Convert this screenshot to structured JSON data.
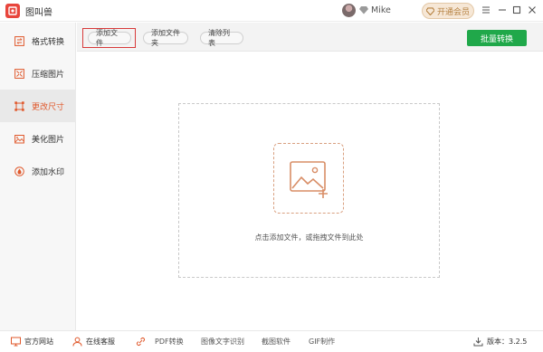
{
  "app": {
    "title": "图叫兽"
  },
  "user": {
    "name": "Mike",
    "member_label": "开通会员"
  },
  "sidebar": {
    "items": [
      {
        "label": "格式转换",
        "icon": "format-convert-icon"
      },
      {
        "label": "压缩图片",
        "icon": "compress-icon"
      },
      {
        "label": "更改尺寸",
        "icon": "resize-icon",
        "active": true
      },
      {
        "label": "美化图片",
        "icon": "beautify-icon"
      },
      {
        "label": "添加水印",
        "icon": "watermark-icon"
      }
    ]
  },
  "toolbar": {
    "add_file": "添加文件",
    "add_folder": "添加文件夹",
    "clear_list": "清除列表",
    "batch_convert": "批量转换"
  },
  "dropzone": {
    "hint": "点击添加文件，或拖拽文件到此处"
  },
  "footer": {
    "website": "官方网站",
    "support": "在线客服",
    "pdf": "PDF转换",
    "ocr": "图像文字识别",
    "screenshot": "截图软件",
    "gif": "GIF制作",
    "version": "版本：3.2.5"
  },
  "colors": {
    "accent": "#e0582b",
    "batch": "#20a84a",
    "logo": "#e8453c"
  }
}
